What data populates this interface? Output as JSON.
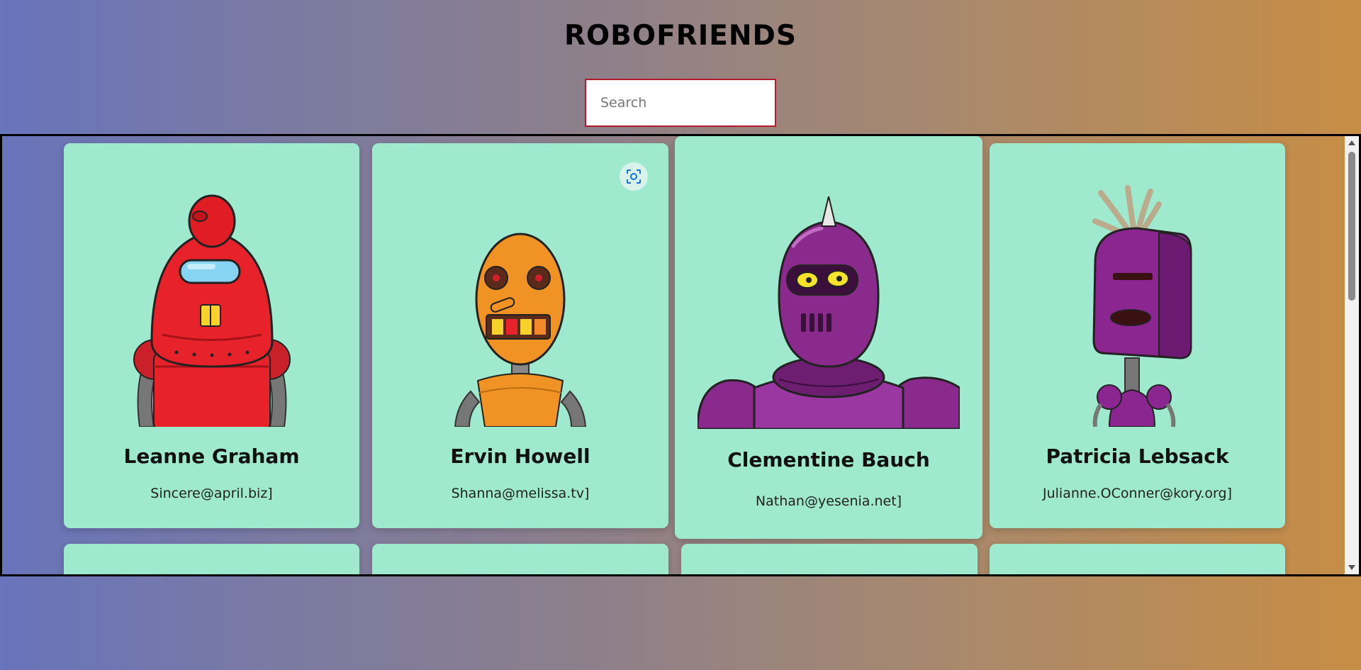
{
  "app": {
    "title": "ROBOFRIENDS"
  },
  "search": {
    "placeholder": "Search",
    "value": ""
  },
  "robots": [
    {
      "name": "Leanne Graham",
      "email": "Sincere@april.biz]",
      "color": "#e8222b"
    },
    {
      "name": "Ervin Howell",
      "email": "Shanna@melissa.tv]",
      "color": "#f19324"
    },
    {
      "name": "Clementine Bauch",
      "email": "Nathan@yesenia.net]",
      "color": "#8a2a8c"
    },
    {
      "name": "Patricia Lebsack",
      "email": "Julianne.OConner@kory.org]",
      "color": "#8b2590"
    }
  ],
  "colors": {
    "card": "#9fe9cf",
    "search_border": "#b51b2a"
  },
  "icons": {
    "scan": "scan-icon"
  }
}
